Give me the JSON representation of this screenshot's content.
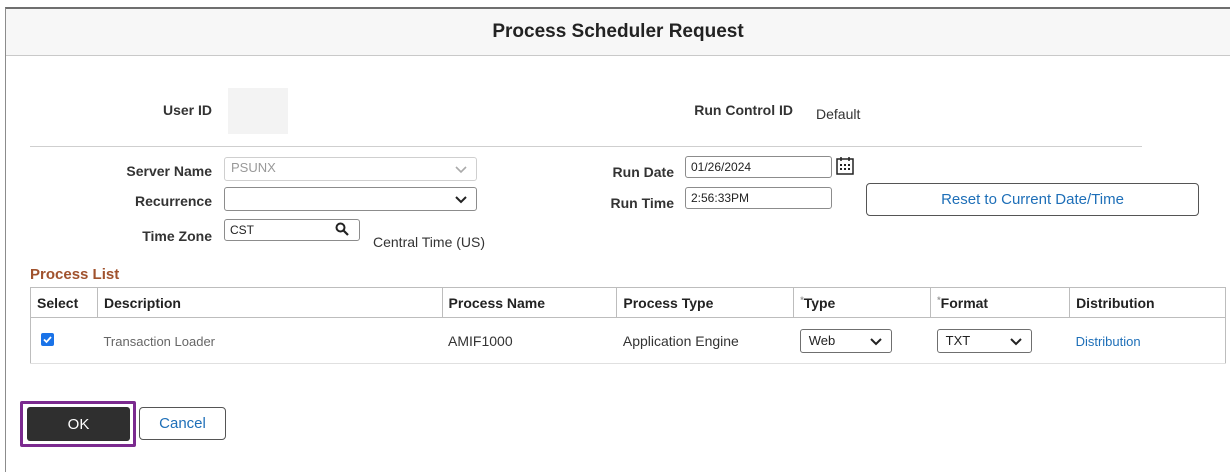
{
  "window": {
    "title": "Process Scheduler Request"
  },
  "form": {
    "user_id_label": "User ID",
    "user_id_value": "",
    "run_control_id_label": "Run Control ID",
    "run_control_id_value": "Default",
    "server_name_label": "Server Name",
    "server_name_value": "PSUNX",
    "recurrence_label": "Recurrence",
    "recurrence_value": "",
    "time_zone_label": "Time Zone",
    "time_zone_value": "CST",
    "time_zone_description": "Central Time (US)",
    "run_date_label": "Run Date",
    "run_date_value": "01/26/2024",
    "run_time_label": "Run Time",
    "run_time_value": "2:56:33PM",
    "reset_button_label": "Reset to Current Date/Time"
  },
  "process_list": {
    "title": "Process List",
    "columns": {
      "select": "Select",
      "description": "Description",
      "process_name": "Process Name",
      "process_type": "Process Type",
      "type": "Type",
      "format": "Format",
      "distribution": "Distribution"
    },
    "required_marker": "*",
    "rows": [
      {
        "selected": true,
        "description": "Transaction Loader",
        "process_name": "AMIF1000",
        "process_type": "Application Engine",
        "type": "Web",
        "format": "TXT",
        "distribution": "Distribution"
      }
    ]
  },
  "actions": {
    "ok_label": "OK",
    "cancel_label": "Cancel"
  },
  "colors": {
    "link": "#1e6fb8",
    "section_title": "#a0522d",
    "ok_button": "#2f2f2f",
    "focus_outline": "#7b2a8f",
    "checkbox": "#1a73e8"
  },
  "icons": [
    "chevron-down-icon",
    "calendar-icon",
    "search-icon",
    "checkbox-checked-icon"
  ]
}
